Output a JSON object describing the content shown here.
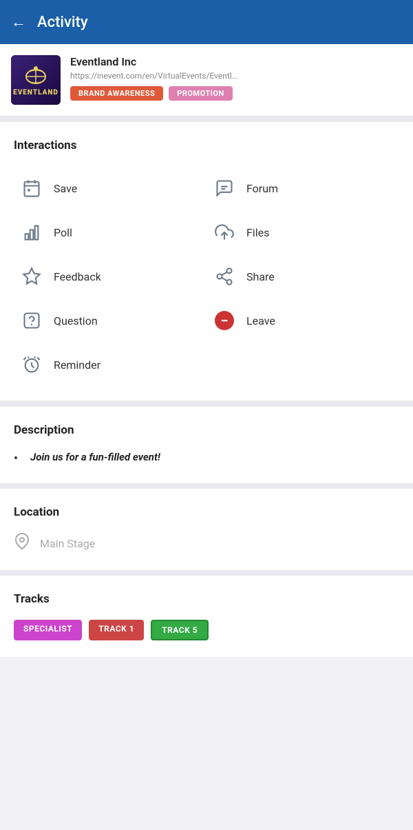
{
  "header": {
    "back_label": "←",
    "title": "Activity"
  },
  "event": {
    "name": "Eventland Inc",
    "url": "https://inevent.com/en/VirtualEvents/Eventl...",
    "logo_text": "EVENTLAND",
    "tags": [
      {
        "label": "BRAND AWARENESS",
        "style": "brand"
      },
      {
        "label": "PROMOTION",
        "style": "promotion"
      }
    ]
  },
  "interactions": {
    "section_title": "Interactions",
    "items_left": [
      {
        "id": "save",
        "label": "Save",
        "icon": "calendar"
      },
      {
        "id": "poll",
        "label": "Poll",
        "icon": "poll"
      },
      {
        "id": "feedback",
        "label": "Feedback",
        "icon": "star"
      },
      {
        "id": "question",
        "label": "Question",
        "icon": "question"
      },
      {
        "id": "reminder",
        "label": "Reminder",
        "icon": "alarm"
      }
    ],
    "items_right": [
      {
        "id": "forum",
        "label": "Forum",
        "icon": "forum"
      },
      {
        "id": "files",
        "label": "Files",
        "icon": "files"
      },
      {
        "id": "share",
        "label": "Share",
        "icon": "share"
      },
      {
        "id": "leave",
        "label": "Leave",
        "icon": "leave"
      }
    ]
  },
  "description": {
    "section_title": "Description",
    "text": "Join us for a fun-filled event!"
  },
  "location": {
    "section_title": "Location",
    "place": "Main Stage"
  },
  "tracks": {
    "section_title": "Tracks",
    "items": [
      {
        "label": "SPECIALIST",
        "style": "specialist"
      },
      {
        "label": "TRACK 1",
        "style": "track1"
      },
      {
        "label": "TRACK 5",
        "style": "track5"
      }
    ]
  }
}
